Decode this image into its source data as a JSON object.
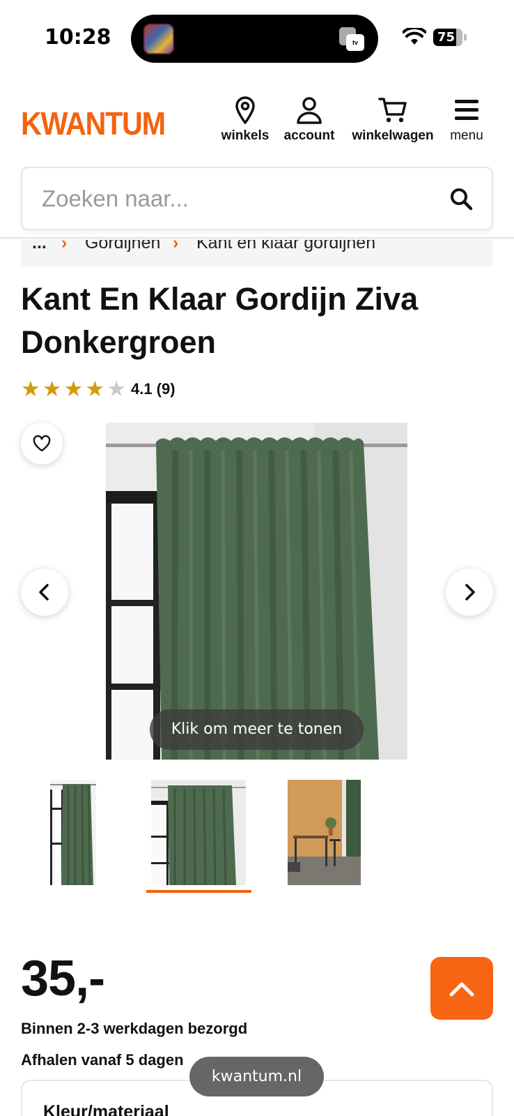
{
  "status_bar": {
    "time": "10:28",
    "battery": "75",
    "island_right_icon": "apple-tv-icon"
  },
  "header": {
    "logo": "KWANTUM",
    "nav": {
      "stores": "winkels",
      "account": "account",
      "cart": "winkelwagen",
      "menu": "menu"
    },
    "accent_color": "#f4630e"
  },
  "search": {
    "placeholder": "Zoeken naar..."
  },
  "breadcrumb": {
    "ellipsis": "...",
    "items": [
      "Gordijnen",
      "Kant en klaar gordijnen"
    ]
  },
  "product": {
    "title": "Kant En Klaar Gordijn Ziva Donkergroen",
    "rating": {
      "stars_full": 4,
      "stars_total": 5,
      "text": "4.1 (9)"
    },
    "gallery": {
      "show_more": "Klik om meer te tonen",
      "thumbnails_count": 3,
      "selected_thumbnail": 2
    },
    "price": "35,-",
    "delivery": "Binnen 2-3 werkdagen bezorgd",
    "pickup": "Afhalen vanaf 5 dagen",
    "options_heading": "Kleur/materiaal"
  },
  "browser": {
    "url": "kwantum.nl"
  }
}
